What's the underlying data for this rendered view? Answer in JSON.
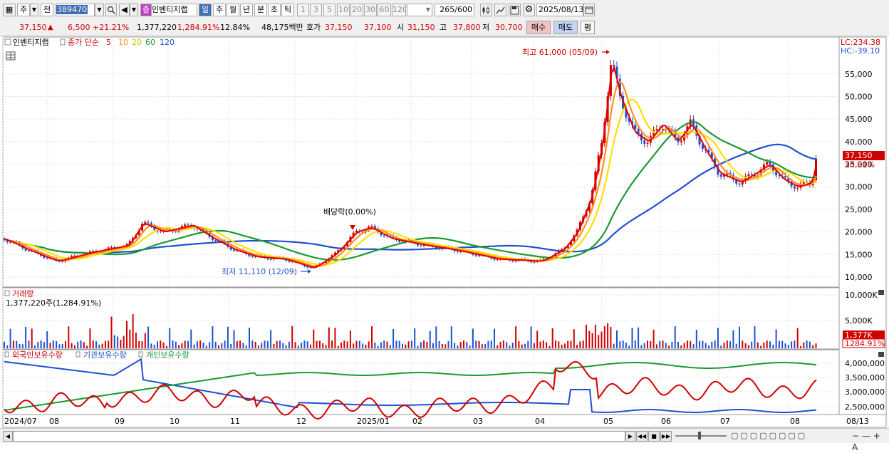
{
  "toolbar": {
    "market_label": "주",
    "prev_label": "전",
    "code": "389470",
    "stock_name": "인벤티지랩",
    "stock_tag": "증",
    "periods": [
      {
        "label": "일",
        "active": true
      },
      {
        "label": "주",
        "active": false
      },
      {
        "label": "월",
        "active": false
      },
      {
        "label": "년",
        "active": false
      },
      {
        "label": "분",
        "active": false
      },
      {
        "label": "초",
        "active": false
      },
      {
        "label": "틱",
        "active": false
      }
    ],
    "intervals": [
      "1",
      "3",
      "5",
      "10",
      "20",
      "30",
      "60",
      "120"
    ],
    "count": "265",
    "count_total": "/600",
    "date": "2025/08/13"
  },
  "quote": {
    "price": "37,150",
    "change": "6,500",
    "change_pct": "+21.21%",
    "volume": "1,377,220",
    "volume_pct": "1,284.91%",
    "turnover_pct": "12.84%",
    "amount": "48,175백만",
    "bid_label": "호가",
    "ask_price": "37,150",
    "bid_price": "37,100",
    "open_label": "시",
    "open": "31,150",
    "high_label": "고",
    "high": "37,800",
    "low_label": "저",
    "low": "30,700",
    "buy_label": "매수",
    "sell_label": "매도",
    "avg_label": "평"
  },
  "price_panel": {
    "legend_name": "인벤티지랩",
    "legend_ma_label": "종가 단순",
    "ma_periods": [
      "5",
      "10",
      "20",
      "60",
      "120"
    ],
    "lc_label": "LC:234.38",
    "hc_label": "HC:-39.10",
    "y_ticks": [
      "55,000",
      "50,000",
      "45,000",
      "40,000",
      "35,000",
      "30,000",
      "25,000",
      "20,000",
      "15,000",
      "10,000"
    ],
    "high_annotation": "최고 61,000 (05/09)",
    "low_annotation": "최저 11,110 (12/09)",
    "dividend_annotation": "배당락(0.00%)",
    "last_price_tag": "37,150",
    "last_pct_tag": "20.81%",
    "colors": {
      "ma5": "#e00000",
      "ma10": "#ff9020",
      "ma20": "#ffe000",
      "ma60": "#1a9a30",
      "ma120": "#2050d0"
    }
  },
  "volume_panel": {
    "title": "거래량",
    "value_label": "1,377,220주(1,284.91%)",
    "y_ticks": [
      "10,000K",
      "5,000K"
    ],
    "last_tag": "1,377K",
    "last_pct_tag": "1284.91%"
  },
  "holding_panel": {
    "series": [
      "외국인보유수량",
      "기관보유수량",
      "개인보유수량"
    ],
    "y_ticks": [
      "4,000,000",
      "3,500,000",
      "3,000,000",
      "2,500,000"
    ],
    "colors": {
      "foreign": "#d00000",
      "institution": "#2050d0",
      "individual": "#1a9a30"
    }
  },
  "x_axis": {
    "labels": [
      "2024/07",
      "08",
      "09",
      "10",
      "11",
      "12",
      "2025/01",
      "02",
      "03",
      "04",
      "05",
      "06",
      "07",
      "08"
    ],
    "right_label": "08/13"
  }
}
